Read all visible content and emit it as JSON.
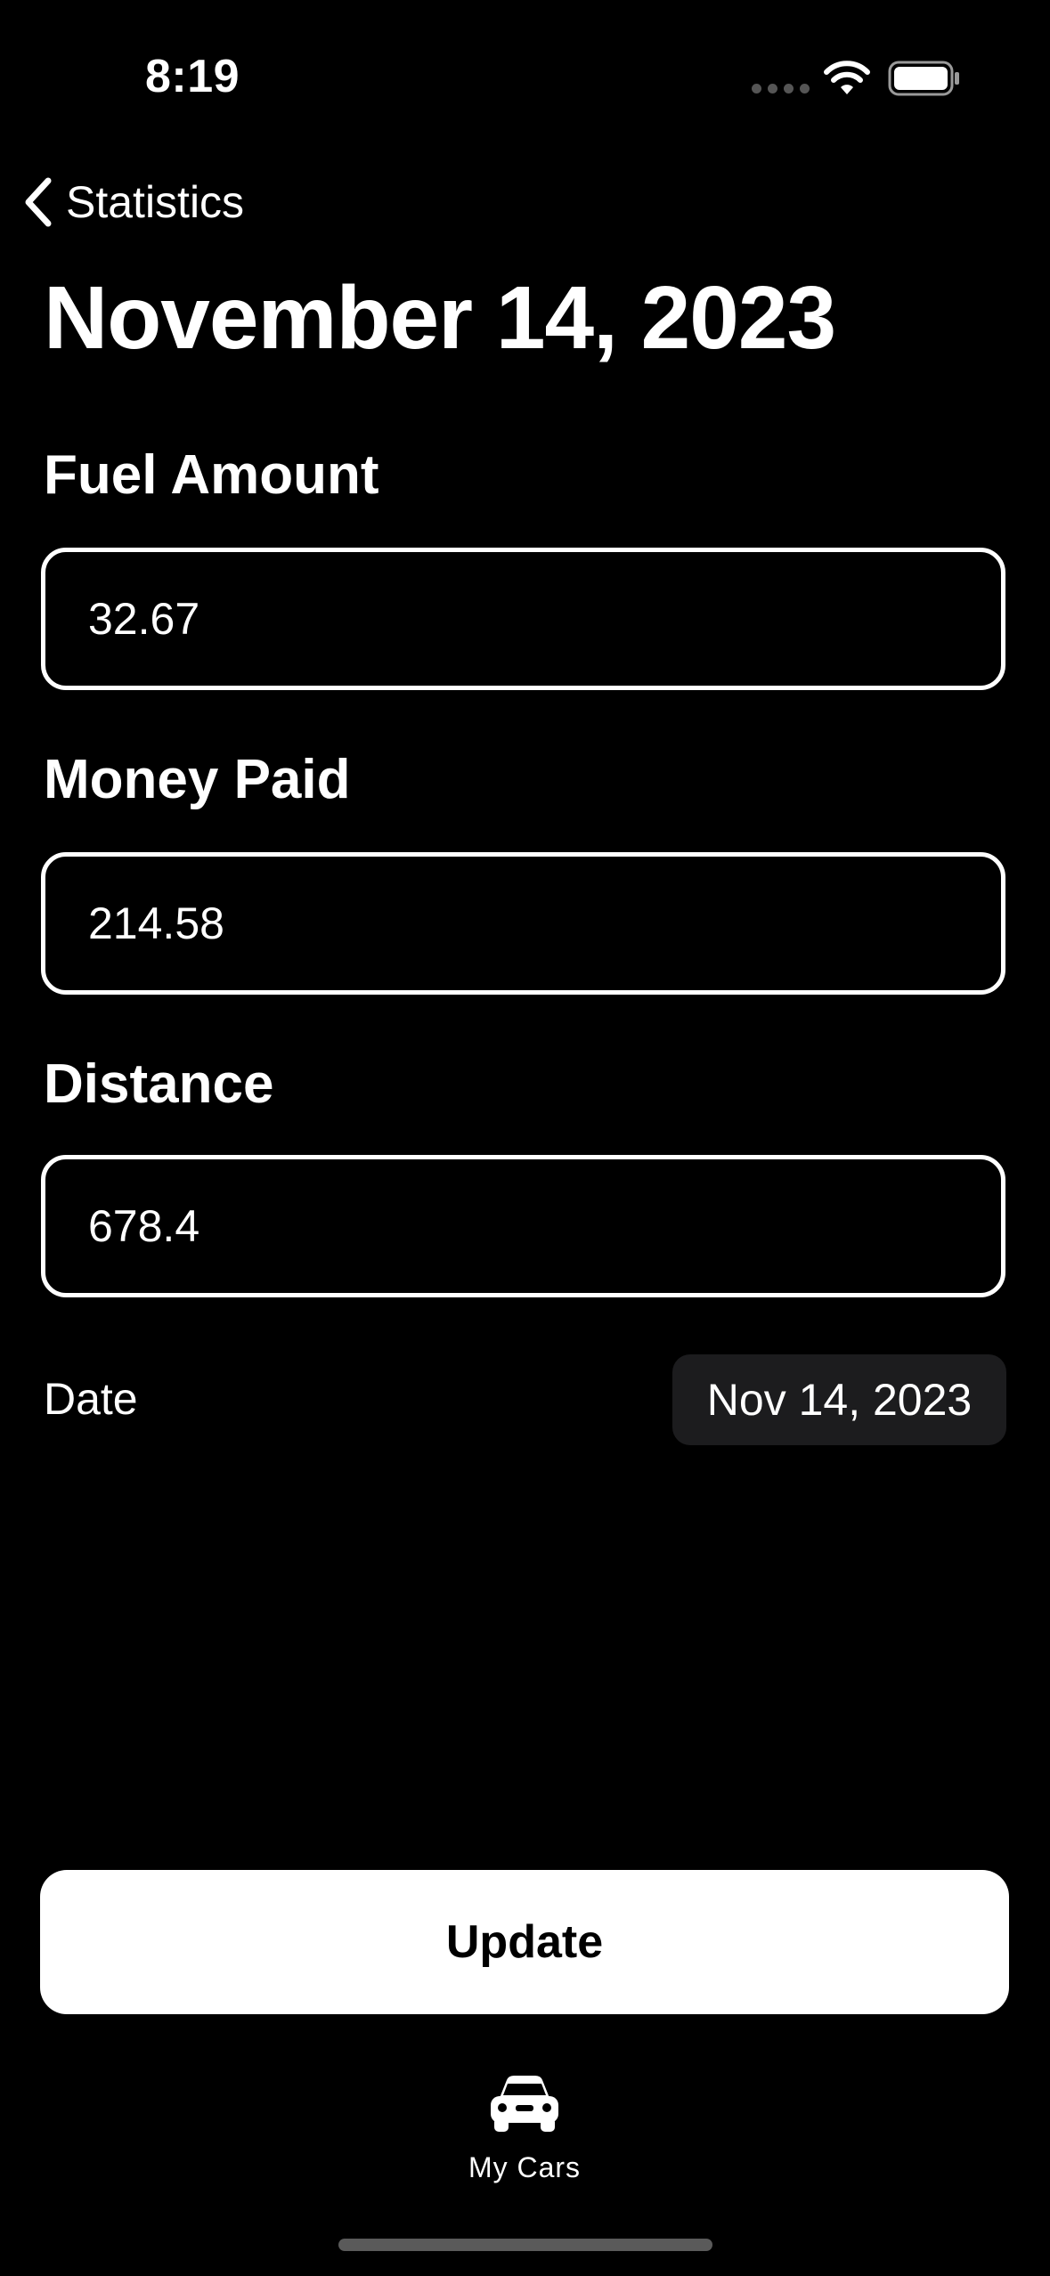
{
  "status_bar": {
    "time": "8:19"
  },
  "nav": {
    "back_label": "Statistics"
  },
  "page": {
    "title": "November 14, 2023"
  },
  "form": {
    "fuel_amount": {
      "label": "Fuel Amount",
      "value": "32.67"
    },
    "money_paid": {
      "label": "Money Paid",
      "value": "214.58"
    },
    "distance": {
      "label": "Distance",
      "value": "678.4"
    },
    "date": {
      "label": "Date",
      "value": "Nov 14, 2023"
    }
  },
  "actions": {
    "update_label": "Update"
  },
  "tab_bar": {
    "items": [
      {
        "label": "My Cars",
        "icon": "car-icon"
      }
    ]
  },
  "colors": {
    "background": "#000000",
    "foreground": "#ffffff",
    "date_pill": "#1c1c1e"
  }
}
